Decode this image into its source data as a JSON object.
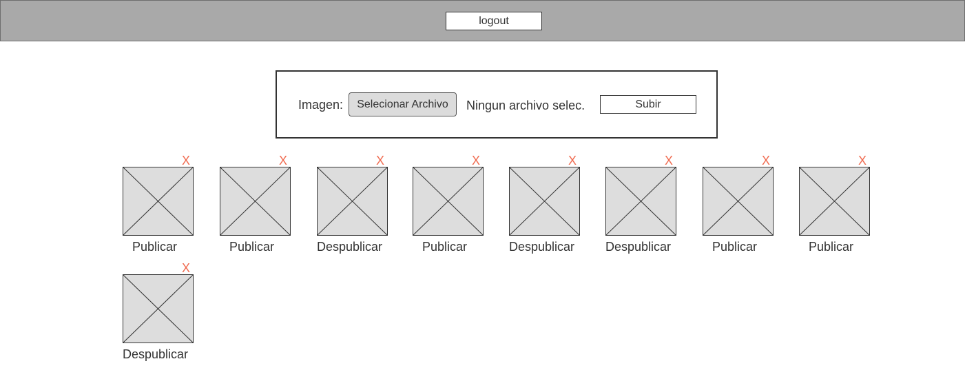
{
  "header": {
    "logout_label": "logout",
    "bg_color": "#a9a9a9"
  },
  "upload": {
    "label": "Imagen:",
    "choose_file_label": "Selecionar Archivo",
    "file_status": "Ningun archivo selec.",
    "submit_label": "Subir"
  },
  "gallery": {
    "delete_glyph": "X",
    "delete_color": "#f06b50",
    "items": [
      {
        "action": "Publicar",
        "icon": "image-placeholder-icon"
      },
      {
        "action": "Publicar",
        "icon": "image-placeholder-icon"
      },
      {
        "action": "Despublicar",
        "icon": "image-placeholder-icon"
      },
      {
        "action": "Publicar",
        "icon": "image-placeholder-icon"
      },
      {
        "action": "Despublicar",
        "icon": "image-placeholder-icon"
      },
      {
        "action": "Despublicar",
        "icon": "image-placeholder-icon"
      },
      {
        "action": "Publicar",
        "icon": "image-placeholder-icon"
      },
      {
        "action": "Publicar",
        "icon": "image-placeholder-icon"
      },
      {
        "action": "Despublicar",
        "icon": "image-placeholder-icon"
      }
    ]
  }
}
